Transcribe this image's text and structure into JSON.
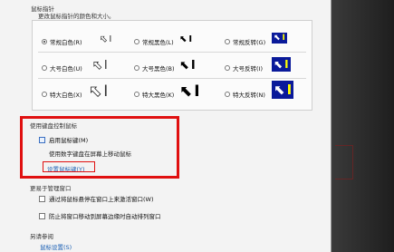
{
  "pointer_section": {
    "title": "鼠标指针",
    "description": "更改鼠标指针的颜色和大小。",
    "schemes": [
      {
        "label": "常规白色(R)",
        "selected": true,
        "style": "white"
      },
      {
        "label": "常规黑色(L)",
        "selected": false,
        "style": "black"
      },
      {
        "label": "常规反转(G)",
        "selected": false,
        "style": "inverted"
      },
      {
        "label": "大号白色(U)",
        "selected": false,
        "style": "white"
      },
      {
        "label": "大号黑色(B)",
        "selected": false,
        "style": "black"
      },
      {
        "label": "大号反转(I)",
        "selected": false,
        "style": "inverted"
      },
      {
        "label": "特大白色(X)",
        "selected": false,
        "style": "white"
      },
      {
        "label": "特大黑色(K)",
        "selected": false,
        "style": "black"
      },
      {
        "label": "特大反转(N)",
        "selected": false,
        "style": "inverted"
      }
    ]
  },
  "keyboard_section": {
    "title": "使用键盘控制鼠标",
    "enable_mouse_keys": "启用鼠标键(M)",
    "hint": "使用数字键盘在屏幕上移动鼠标",
    "setup_link": "设置鼠标键(Y)"
  },
  "window_section": {
    "title": "更易于管理窗口",
    "option1": "通过将鼠标悬停在窗口上来激活窗口(W)",
    "option2": "防止将窗口移动到屏幕边缘时自动排列窗口"
  },
  "see_also": {
    "title": "另请参阅",
    "link": "鼠标设置(S)"
  },
  "colors": {
    "highlight": "#e01010",
    "link": "#1a5fb4",
    "inverted_bg": "#0a1a9a"
  }
}
